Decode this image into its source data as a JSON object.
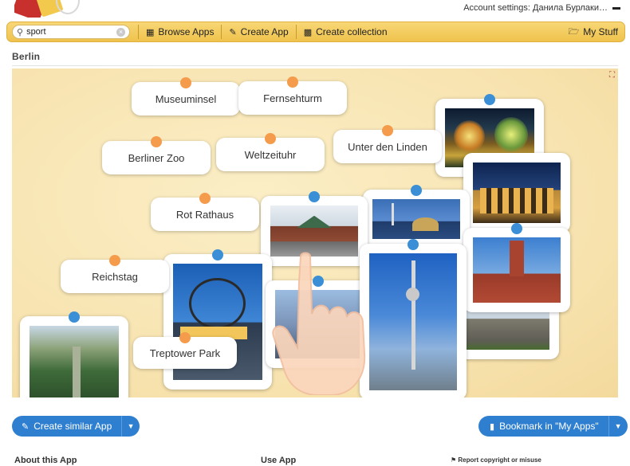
{
  "header": {
    "account_text": "Account settings: Данила Бурлаки…"
  },
  "toolbar": {
    "search_value": "sport",
    "browse_label": "Browse Apps",
    "create_app_label": "Create App",
    "create_collection_label": "Create collection",
    "my_stuff_label": "My Stuff"
  },
  "app": {
    "title": "Berlin"
  },
  "board": {
    "labels": [
      "Museuminsel",
      "Fernsehturm",
      "Berliner Zoo",
      "Weltzeituhr",
      "Unter den Linden",
      "Rot Rathaus",
      "Reichstag",
      "Treptower Park"
    ]
  },
  "actions": {
    "create_similar": "Create similar App",
    "bookmark": "Bookmark in \"My Apps\""
  },
  "footer": {
    "about": "About this App",
    "use": "Use App",
    "report": "Report copyright or misuse"
  },
  "colors": {
    "toolbar_accent": "#efc24c",
    "button_blue": "#2f7fd1",
    "pin_orange": "#f59b4c",
    "pin_blue": "#3a8fd6",
    "board_bg": "#f7e2ad"
  },
  "icons": {
    "search": "search-icon",
    "browse": "grid-icon",
    "create_app": "pencil-icon",
    "create_collection": "collection-icon",
    "my_stuff": "folder-icon",
    "fullscreen": "fullscreen-icon",
    "edit": "edit-icon",
    "bookmark": "bookmark-icon",
    "flag": "flag-icon"
  }
}
